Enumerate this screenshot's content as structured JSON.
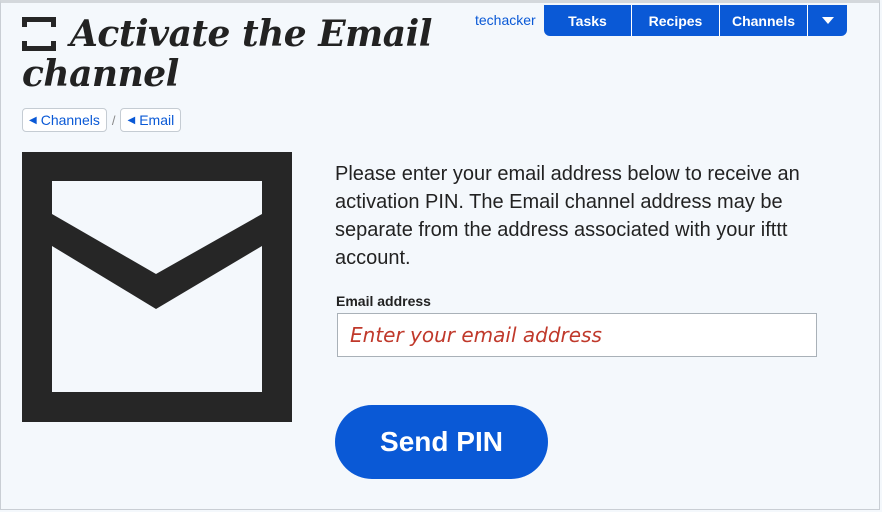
{
  "header": {
    "title": "Activate the Email channel",
    "logo_icon": "ifttt-logo-icon"
  },
  "breadcrumb": {
    "items": [
      {
        "label": "Channels",
        "icon": "left-triangle-icon"
      },
      {
        "label": "Email",
        "icon": "left-triangle-icon"
      }
    ],
    "separator": "/"
  },
  "nav": {
    "username": "techacker",
    "items": [
      {
        "label": "Tasks"
      },
      {
        "label": "Recipes"
      },
      {
        "label": "Channels"
      }
    ],
    "more_icon": "chevron-down-icon"
  },
  "main": {
    "channel_icon": "email-envelope-icon",
    "description": "Please enter your email address below to receive an activation PIN. The Email channel address may be separate from the address associated with your ifttt account.",
    "field_label": "Email address",
    "email_placeholder": "Enter your email address",
    "email_value": "",
    "send_button_label": "Send PIN"
  },
  "colors": {
    "accent": "#0a59d6",
    "background": "#f4f8fc",
    "placeholder": "#c0392b",
    "icon": "#262626"
  }
}
